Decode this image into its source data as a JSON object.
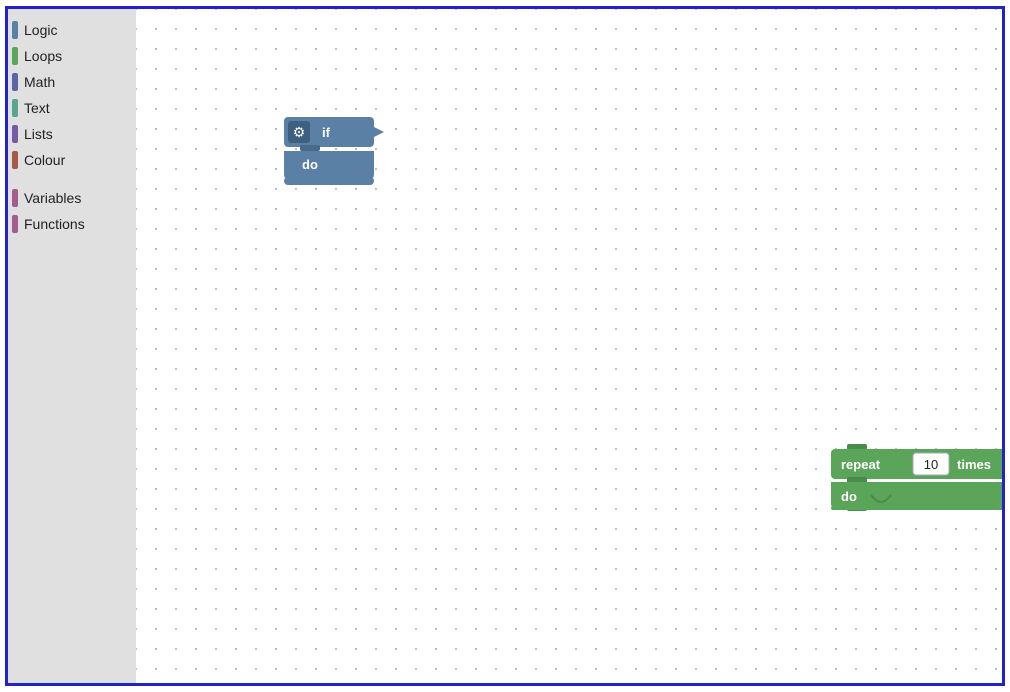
{
  "sidebar": {
    "items": [
      {
        "id": "logic",
        "label": "Logic",
        "color": "#5b80a5"
      },
      {
        "id": "loops",
        "label": "Loops",
        "color": "#5ba55b"
      },
      {
        "id": "math",
        "label": "Math",
        "color": "#5b67a5"
      },
      {
        "id": "text",
        "label": "Text",
        "color": "#5ba58c"
      },
      {
        "id": "lists",
        "label": "Lists",
        "color": "#745ba5"
      },
      {
        "id": "colour",
        "label": "Colour",
        "color": "#a55b45"
      }
    ],
    "gap_items": [
      {
        "id": "variables",
        "label": "Variables",
        "color": "#a55b8c"
      },
      {
        "id": "functions",
        "label": "Functions",
        "color": "#a55b8c"
      }
    ]
  },
  "blocks": {
    "if_block": {
      "if_label": "if",
      "do_label": "do"
    },
    "repeat_block": {
      "repeat_label": "repeat",
      "number": "10",
      "times_label": "times",
      "do_label": "do"
    }
  }
}
